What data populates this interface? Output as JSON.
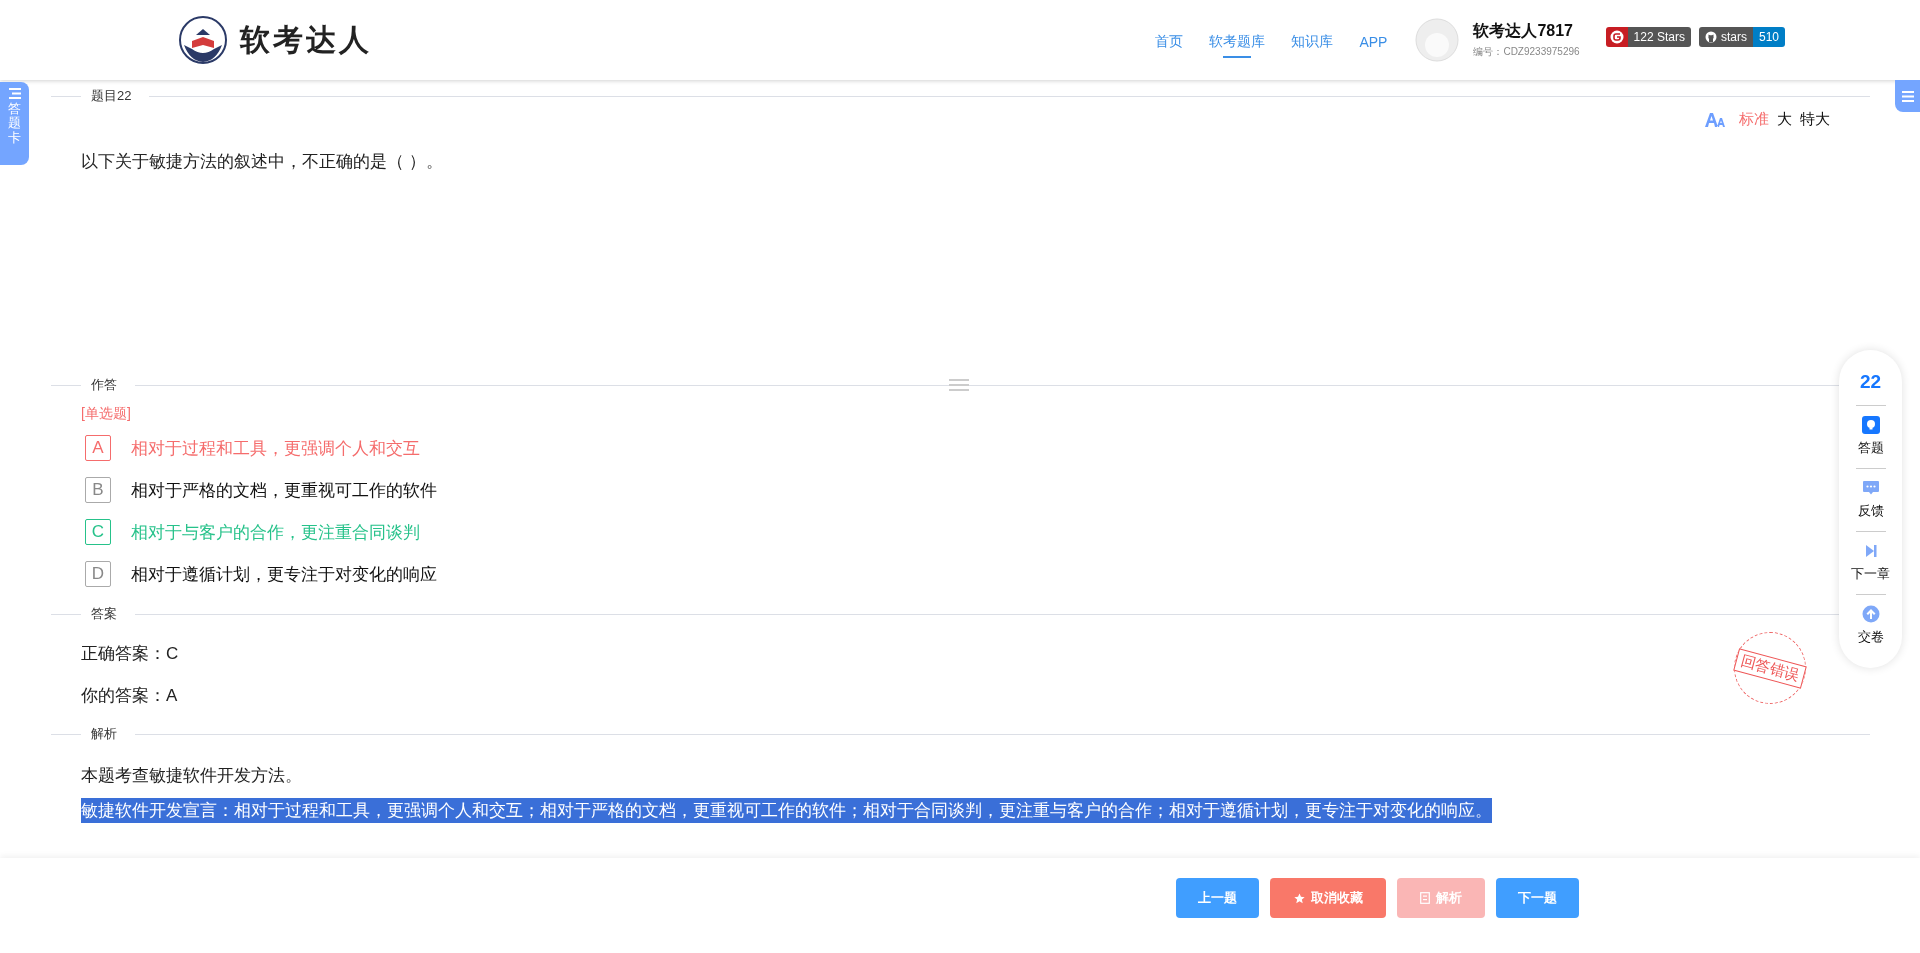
{
  "header": {
    "logo_text": "软考达人",
    "nav": [
      {
        "label": "首页",
        "selected": false
      },
      {
        "label": "软考题库",
        "selected": true
      },
      {
        "label": "知识库",
        "selected": false
      },
      {
        "label": "APP",
        "selected": false
      }
    ],
    "user": {
      "name": "软考达人7817",
      "id": "编号：CDZ9233975296"
    },
    "badges": [
      {
        "kind": "gitee",
        "label": "122 Stars"
      },
      {
        "kind": "github",
        "label": "stars",
        "count": "510"
      }
    ]
  },
  "side_tab": {
    "label": "答题卡"
  },
  "question": {
    "section": "题目22",
    "font_sizes": [
      {
        "label": "标准",
        "selected": true
      },
      {
        "label": "大",
        "selected": false
      },
      {
        "label": "特大",
        "selected": false
      }
    ],
    "text": "以下关于敏捷方法的叙述中，不正确的是（ ）。"
  },
  "answer_section": {
    "title": "作答",
    "type": "[单选题]",
    "options": [
      {
        "letter": "A",
        "text": "相对于过程和工具，更强调个人和交互",
        "selected": true,
        "correct": false
      },
      {
        "letter": "B",
        "text": "相对于严格的文档，更重视可工作的软件",
        "selected": false,
        "correct": false
      },
      {
        "letter": "C",
        "text": "相对于与客户的合作，更注重合同谈判",
        "selected": false,
        "correct": true
      },
      {
        "letter": "D",
        "text": "相对于遵循计划，更专注于对变化的响应",
        "selected": false,
        "correct": false
      }
    ]
  },
  "result": {
    "title": "答案",
    "correct": "正确答案：C",
    "yours": "你的答案：A",
    "stamp": "回答错误"
  },
  "analysis": {
    "title": "解析",
    "lines": [
      {
        "text": "本题考查敏捷软件开发方法。",
        "selected": false
      },
      {
        "text": "敏捷软件开发宣言：相对于过程和工具，更强调个人和交互；相对于严格的文档，更重视可工作的软件；相对于合同谈判，更注重与客户的合作；相对于遵循计划，更专注于对变化的响应。",
        "selected": true
      }
    ]
  },
  "float_panel": {
    "number": "22",
    "items": [
      {
        "kind": "answer",
        "label": "答题"
      },
      {
        "kind": "feedback",
        "label": "反馈"
      },
      {
        "kind": "next",
        "label": "下一章"
      },
      {
        "kind": "submit",
        "label": "交卷"
      }
    ]
  },
  "buttons": [
    {
      "label": "上一题",
      "kind": "primary",
      "disabled": false
    },
    {
      "label": "取消收藏",
      "kind": "star",
      "disabled": false
    },
    {
      "label": "解析",
      "kind": "doc",
      "disabled": true
    },
    {
      "label": "下一题",
      "kind": "primary",
      "disabled": false
    }
  ]
}
